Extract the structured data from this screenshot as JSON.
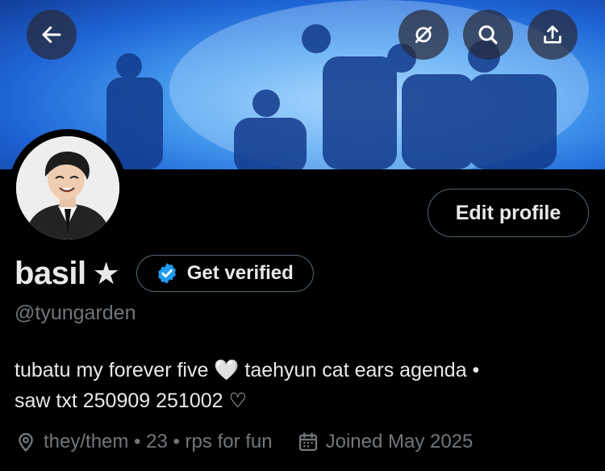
{
  "header": {
    "back_icon": "arrow-left-icon",
    "actions": [
      {
        "name": "grok-icon"
      },
      {
        "name": "search-icon"
      },
      {
        "name": "share-icon"
      }
    ]
  },
  "profile": {
    "display_name": "basil",
    "name_suffix": "★",
    "handle": "@tyungarden",
    "bio_line1": "tubatu my forever five 🤍 taehyun cat ears agenda •",
    "bio_line2": "saw txt 250909 251002 ♡",
    "location": "they/them • 23 • rps for fun",
    "joined": "Joined May 2025"
  },
  "buttons": {
    "edit_profile": "Edit profile",
    "get_verified": "Get verified"
  },
  "colors": {
    "background": "#000000",
    "primary_text": "#e7e9ea",
    "secondary_text": "#71767b",
    "verified_blue": "#1d9bf0",
    "border": "#536471"
  }
}
